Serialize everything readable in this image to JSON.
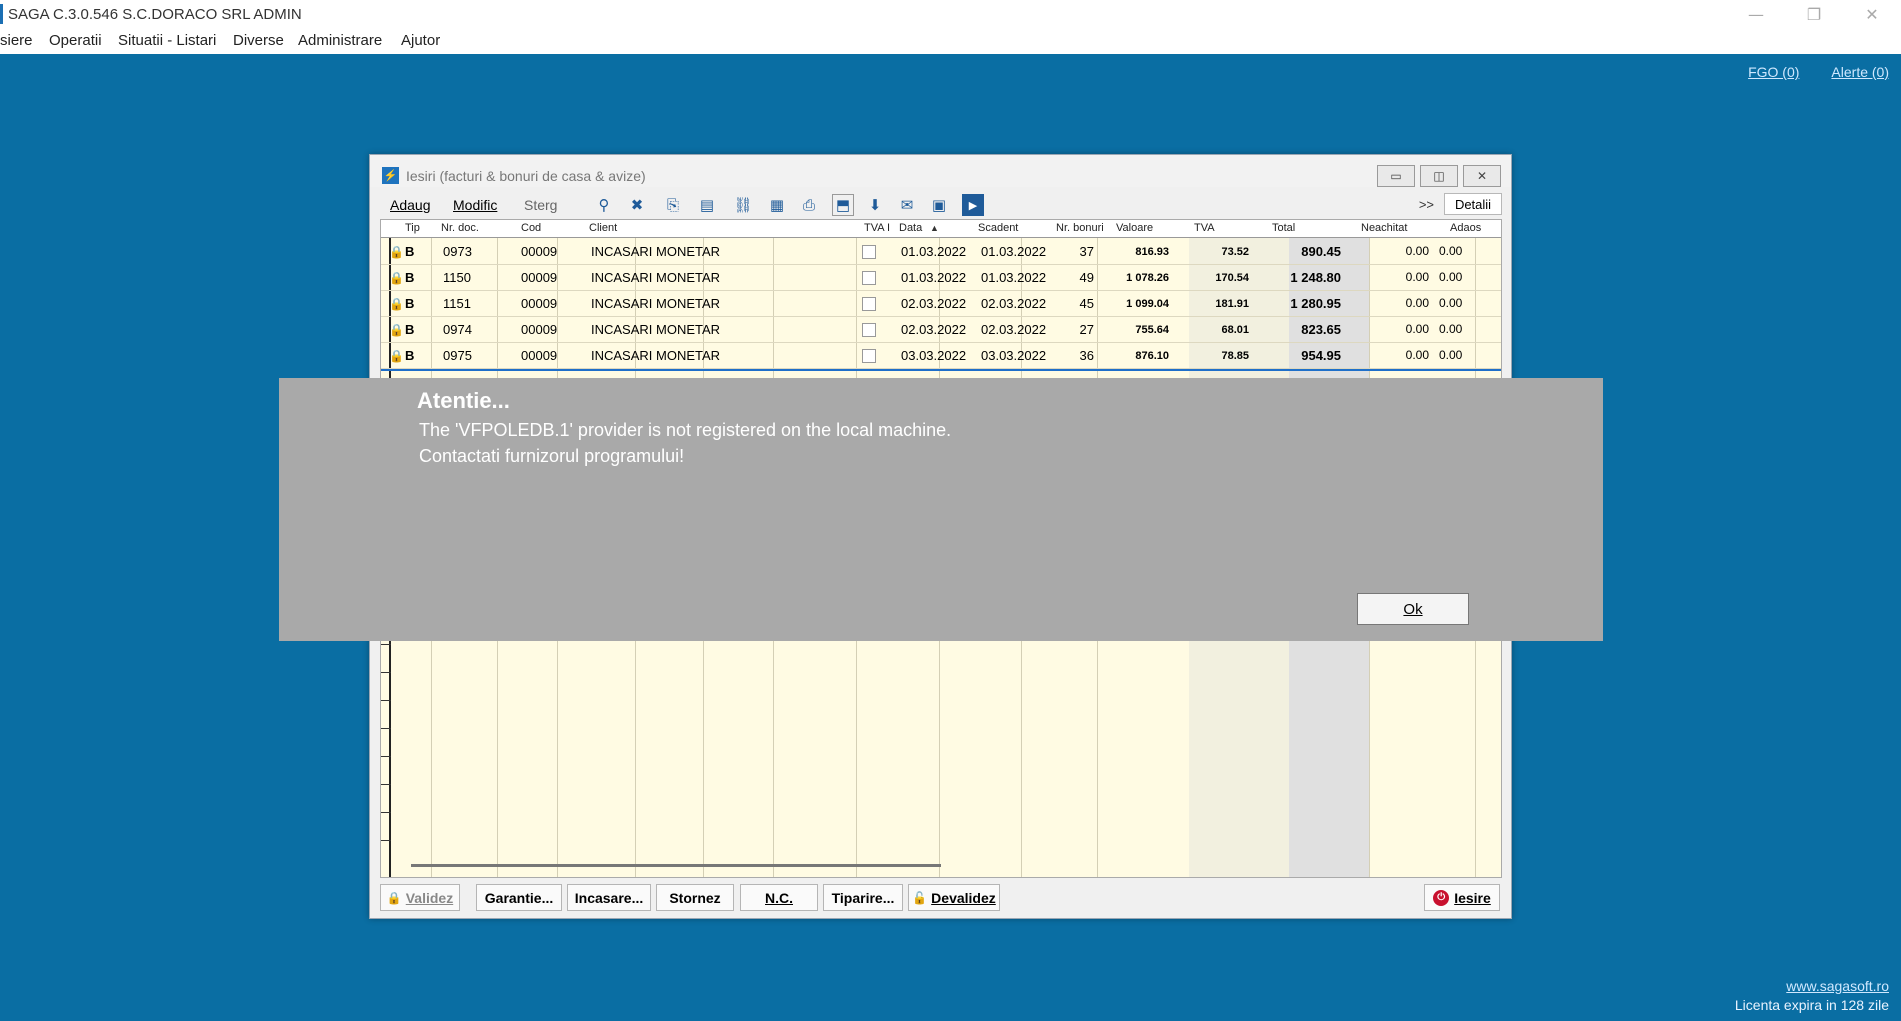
{
  "app": {
    "title": "SAGA C.3.0.546  S.C.DORACO SRL  ADMIN",
    "menu": [
      "siere",
      "Operatii",
      "Situatii - Listari",
      "Diverse",
      "Administrare",
      "Ajutor"
    ],
    "controls": {
      "minimize": "—",
      "restore": "❐",
      "close": "✕"
    }
  },
  "toplinks": {
    "fgo": "FGO (0)",
    "alerte": "Alerte (0)"
  },
  "footer": {
    "site": "www.sagasoft.ro",
    "license": "Licenta expira in 128 zile"
  },
  "window": {
    "title": "Iesiri (facturi & bonuri de casa & avize)",
    "icon": "⚡",
    "toolbar": {
      "adaug": "Adaug",
      "modific": "Modific",
      "sterg": "Sterg",
      "more": ">>",
      "detalii": "Detalii"
    },
    "columns": [
      "Tip",
      "Nr. doc.",
      "Cod",
      "Client",
      "TVA I",
      "Data",
      "Scadent",
      "Nr. bonuri",
      "Valoare",
      "TVA",
      "Total",
      "Neachitat",
      "Adaos"
    ],
    "rows": [
      {
        "tip": "B",
        "nr": "0973",
        "cod": "00009",
        "client": "INCASARI MONETAR",
        "data": "01.03.2022",
        "scadent": "01.03.2022",
        "bonuri": "37",
        "valoare": "816.93",
        "tva": "73.52",
        "total": "890.45",
        "neachitat": "0.00",
        "adaos": "0.00"
      },
      {
        "tip": "B",
        "nr": "1150",
        "cod": "00009",
        "client": "INCASARI MONETAR",
        "data": "01.03.2022",
        "scadent": "01.03.2022",
        "bonuri": "49",
        "valoare": "1 078.26",
        "tva": "170.54",
        "total": "1 248.80",
        "neachitat": "0.00",
        "adaos": "0.00"
      },
      {
        "tip": "B",
        "nr": "1151",
        "cod": "00009",
        "client": "INCASARI MONETAR",
        "data": "02.03.2022",
        "scadent": "02.03.2022",
        "bonuri": "45",
        "valoare": "1 099.04",
        "tva": "181.91",
        "total": "1 280.95",
        "neachitat": "0.00",
        "adaos": "0.00"
      },
      {
        "tip": "B",
        "nr": "0974",
        "cod": "00009",
        "client": "INCASARI MONETAR",
        "data": "02.03.2022",
        "scadent": "02.03.2022",
        "bonuri": "27",
        "valoare": "755.64",
        "tva": "68.01",
        "total": "823.65",
        "neachitat": "0.00",
        "adaos": "0.00"
      },
      {
        "tip": "B",
        "nr": "0975",
        "cod": "00009",
        "client": "INCASARI MONETAR",
        "data": "03.03.2022",
        "scadent": "03.03.2022",
        "bonuri": "36",
        "valoare": "876.10",
        "tva": "78.85",
        "total": "954.95",
        "neachitat": "0.00",
        "adaos": "0.00"
      }
    ],
    "buttons": {
      "validez": "Validez",
      "garantie": "Garantie...",
      "incasare": "Incasare...",
      "stornez": "Stornez",
      "nc": "N.C.",
      "tiparire": "Tiparire...",
      "devalidez": "Devalidez",
      "iesire": "Iesire"
    }
  },
  "dialog": {
    "title": "Atentie...",
    "line1": "The 'VFPOLEDB.1' provider is not registered on the local machine.",
    "line2": "Contactati furnizorul programului!",
    "ok": "Ok"
  }
}
